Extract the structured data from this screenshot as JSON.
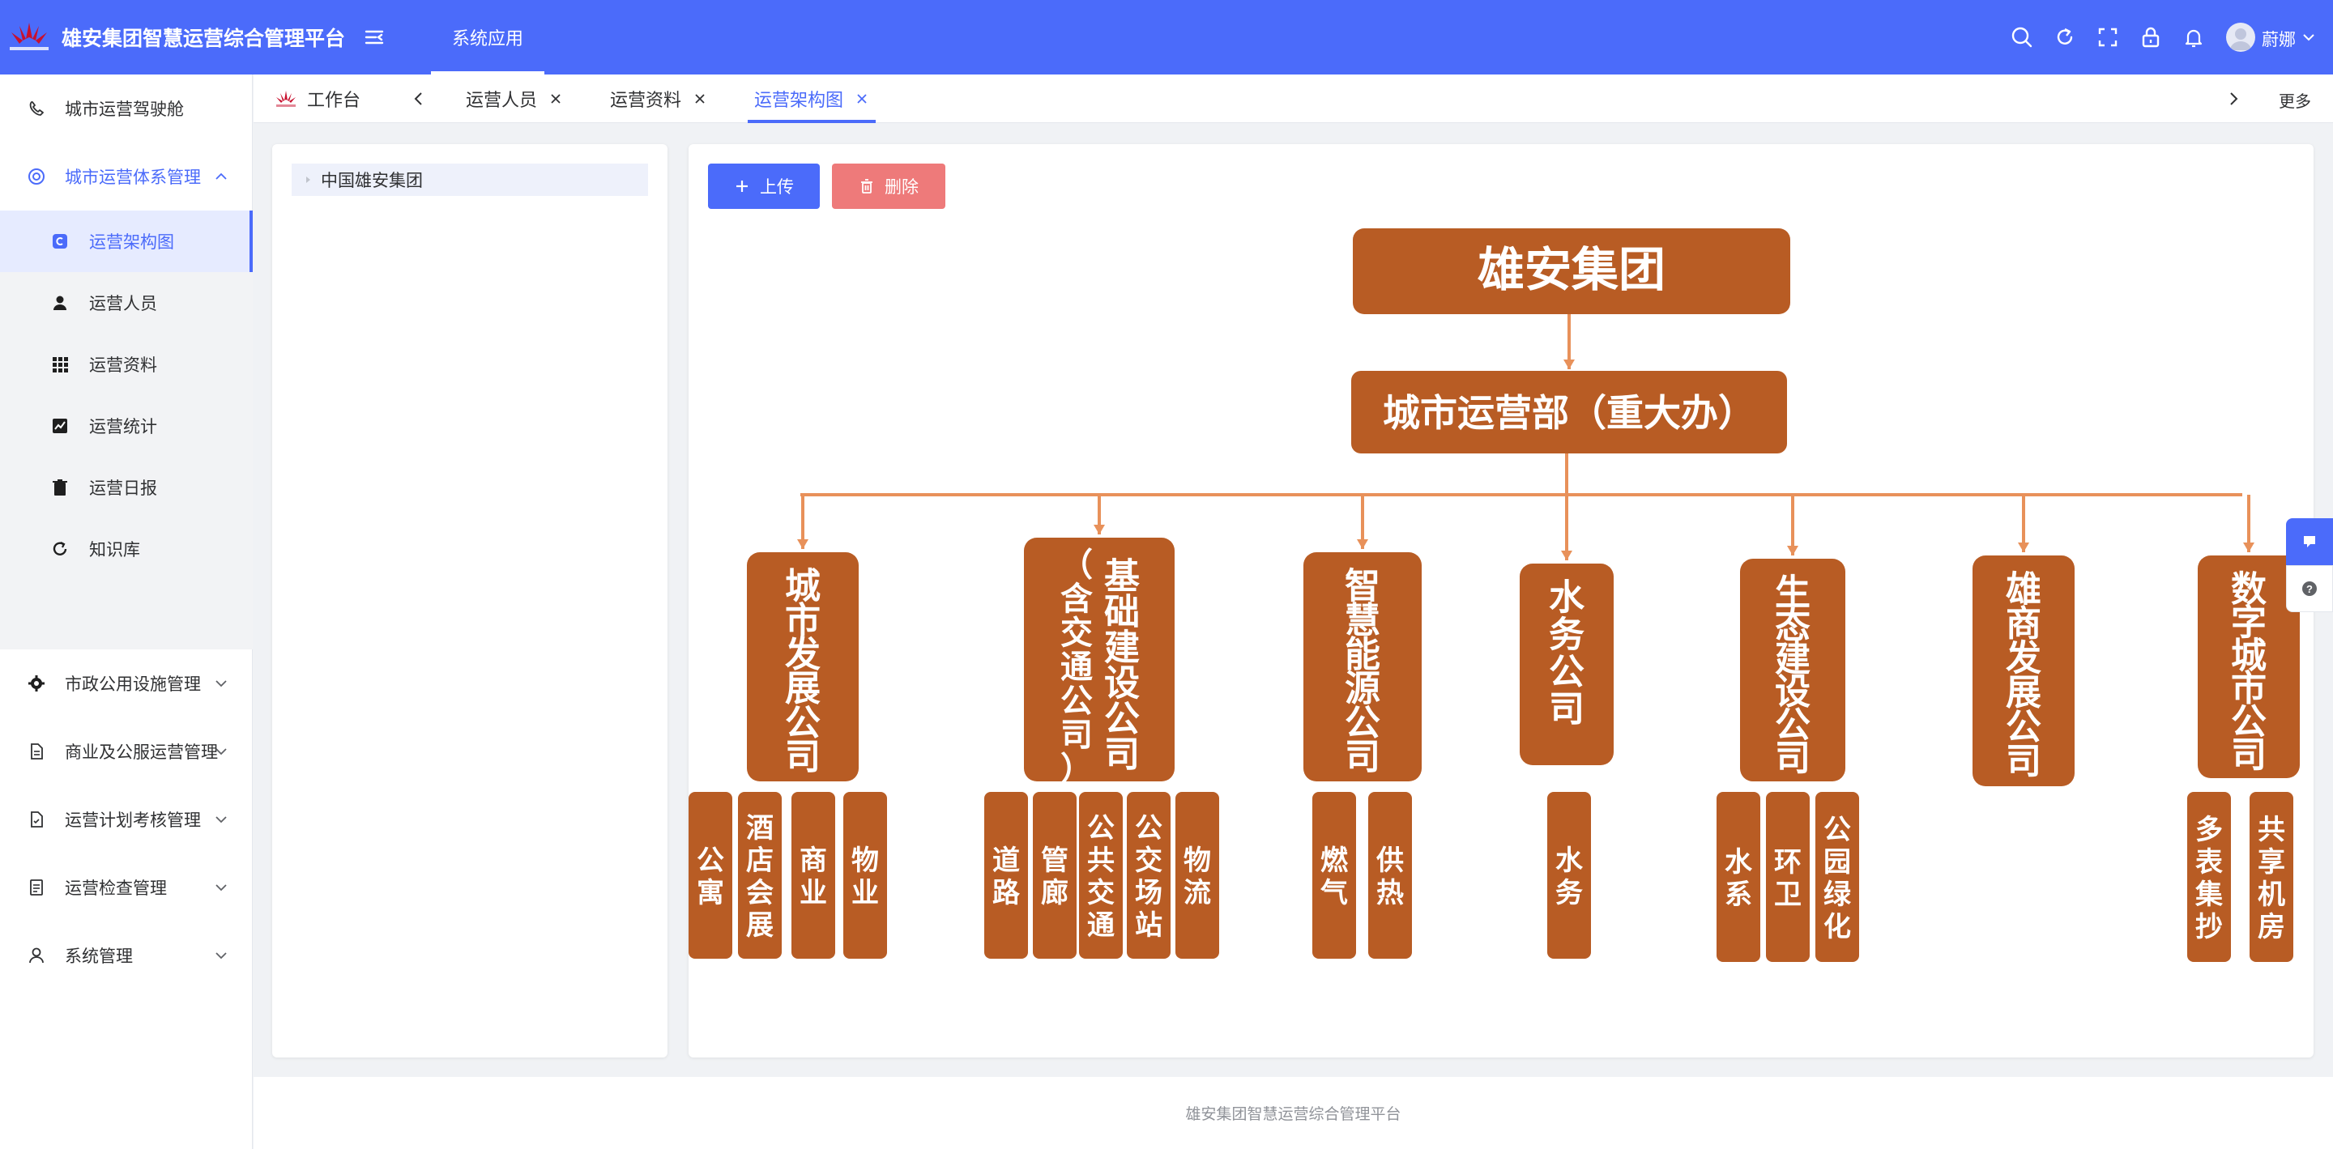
{
  "header": {
    "title": "雄安集团智慧运营综合管理平台",
    "top_tab": "系统应用",
    "username": "蔚娜",
    "colors": {
      "primary": "#4b6bfa",
      "org_box": "#b85c24",
      "org_line": "#e8915a"
    }
  },
  "sidebar": {
    "items": [
      {
        "label": "城市运营驾驶舱",
        "icon": "cockpit-icon"
      },
      {
        "label": "城市运营体系管理",
        "icon": "target-icon",
        "open": true
      },
      {
        "label": "市政公用设施管理",
        "icon": "gear-icon"
      },
      {
        "label": "商业及公服运营管理",
        "icon": "document-icon"
      },
      {
        "label": "运营计划考核管理",
        "icon": "checklist-icon"
      },
      {
        "label": "运营检查管理",
        "icon": "file-list-icon"
      },
      {
        "label": "系统管理",
        "icon": "user-icon"
      }
    ],
    "sub_items": [
      {
        "label": "运营架构图",
        "icon": "org-icon",
        "active": true
      },
      {
        "label": "运营人员",
        "icon": "person-icon"
      },
      {
        "label": "运营资料",
        "icon": "grid-icon"
      },
      {
        "label": "运营统计",
        "icon": "chart-icon"
      },
      {
        "label": "运营日报",
        "icon": "trash-icon"
      },
      {
        "label": "知识库",
        "icon": "refresh-icon"
      }
    ]
  },
  "tabs": {
    "items": [
      {
        "label": "工作台",
        "closable": false
      },
      {
        "label": "运营人员",
        "closable": true
      },
      {
        "label": "运营资料",
        "closable": true
      },
      {
        "label": "运营架构图",
        "closable": true,
        "active": true
      }
    ],
    "more": "更多"
  },
  "tree": {
    "root": "中国雄安集团"
  },
  "actions": {
    "upload": "上传",
    "delete": "删除"
  },
  "org_chart": {
    "root": "雄安集团",
    "department": "城市运营部（重大办）",
    "companies": [
      {
        "name": "城市发展公司",
        "units": [
          "公寓",
          "酒店会展",
          "商业",
          "物业"
        ]
      },
      {
        "name": "基础建设公司（含交通公司）",
        "units": [
          "道路",
          "管廊",
          "公共交通",
          "公交场站",
          "物流"
        ]
      },
      {
        "name": "智慧能源公司",
        "units": [
          "燃气",
          "供热"
        ]
      },
      {
        "name": "水务公司",
        "units": [
          "水务"
        ]
      },
      {
        "name": "生态建设公司",
        "units": [
          "水系",
          "环卫",
          "公园绿化"
        ]
      },
      {
        "name": "雄商发展公司",
        "units": []
      },
      {
        "name": "数字城市公司",
        "units": [
          "多表集抄",
          "共享机房"
        ]
      }
    ]
  },
  "footer": {
    "text": "雄安集团智慧运营综合管理平台"
  }
}
